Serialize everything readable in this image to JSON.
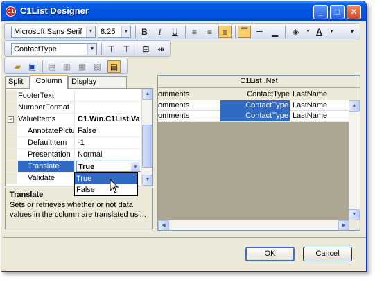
{
  "window": {
    "title": "C1List Designer"
  },
  "toolbar": {
    "font_name": "Microsoft Sans Serif",
    "font_size": "8.25",
    "bold": "B",
    "italic": "I",
    "underline": "U",
    "column_selector": "ContactType"
  },
  "tabs": [
    "Split",
    "Column",
    "Display Column"
  ],
  "properties": [
    {
      "name": "FooterText",
      "value": ""
    },
    {
      "name": "NumberFormat",
      "value": ""
    },
    {
      "name": "ValueItems",
      "value": "C1.Win.C1List.Va"
    },
    {
      "name": "AnnotatePicture",
      "value": "False"
    },
    {
      "name": "DefaultItem",
      "value": "-1"
    },
    {
      "name": "Presentation",
      "value": "Normal"
    },
    {
      "name": "Translate",
      "value": "True"
    },
    {
      "name": "Validate",
      "value": ""
    }
  ],
  "dropdown_options": [
    "True",
    "False"
  ],
  "description": {
    "title": "Translate",
    "text": "Sets or retrieves whether or not data values in the column are translated usi..."
  },
  "preview": {
    "caption": "C1List .Net",
    "columns": [
      "omments",
      "ContactType",
      "LastName"
    ],
    "rows": [
      [
        "omments",
        "ContactType",
        "LastName"
      ],
      [
        "omments",
        "ContactType",
        "LastName"
      ]
    ]
  },
  "buttons": {
    "ok": "OK",
    "cancel": "Cancel"
  }
}
